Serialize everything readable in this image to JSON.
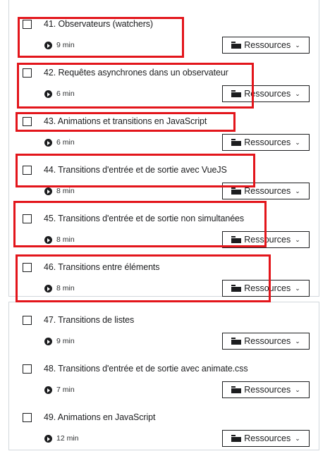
{
  "lectures": [
    {
      "number_title": "41. Observateurs (watchers)",
      "duration": "9 min",
      "button": "Ressources"
    },
    {
      "number_title": "42. Requêtes asynchrones dans un observateur",
      "duration": "6 min",
      "button": "Ressources"
    },
    {
      "number_title": "43. Animations et transitions en JavaScript",
      "duration": "6 min",
      "button": "Ressources"
    },
    {
      "number_title": "44. Transitions d'entrée et de sortie avec VueJS",
      "duration": "8 min",
      "button": "Ressources"
    },
    {
      "number_title": "45. Transitions d'entrée et de sortie non simultanées",
      "duration": "8 min",
      "button": "Ressources"
    },
    {
      "number_title": "46. Transitions entre éléments",
      "duration": "8 min",
      "button": "Ressources"
    },
    {
      "number_title": "47. Transitions de listes",
      "duration": "9 min",
      "button": "Ressources"
    },
    {
      "number_title": "48. Transitions d'entrée et de sortie avec animate.css",
      "duration": "7 min",
      "button": "Ressources"
    },
    {
      "number_title": "49. Animations en JavaScript",
      "duration": "12 min",
      "button": "Ressources"
    }
  ],
  "icons": {
    "play": "play-circle-icon",
    "folder": "folder-icon",
    "chevron": "chevron-down-icon"
  },
  "colors": {
    "highlight": "#e3151b",
    "text": "#1c1d1f",
    "border": "#d1d7dc"
  }
}
